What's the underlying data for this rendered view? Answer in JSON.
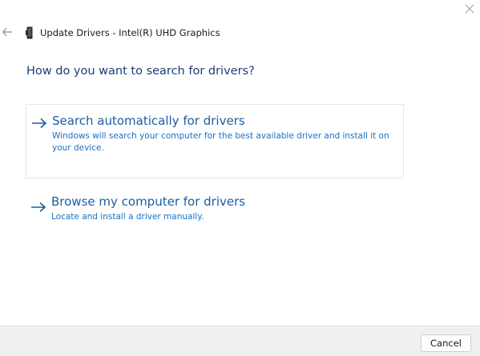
{
  "window": {
    "title": "Update Drivers - Intel(R) UHD Graphics",
    "back_icon": "back-arrow-icon",
    "close_icon": "close-icon",
    "device_icon": "graphics-device-icon"
  },
  "heading": "How do you want to search for drivers?",
  "options": [
    {
      "title": "Search automatically for drivers",
      "description": "Windows will search your computer for the best available driver and install it on your device.",
      "icon": "arrow-right-icon"
    },
    {
      "title": "Browse my computer for drivers",
      "description": "Locate and install a driver manually.",
      "icon": "arrow-right-icon"
    }
  ],
  "footer": {
    "cancel_label": "Cancel"
  },
  "colors": {
    "heading": "#1b3d78",
    "option_title": "#1a5fa3",
    "option_description": "#1a6fbf",
    "footer_background": "#f0f0f0",
    "selected_border": "#e6e6e6"
  }
}
